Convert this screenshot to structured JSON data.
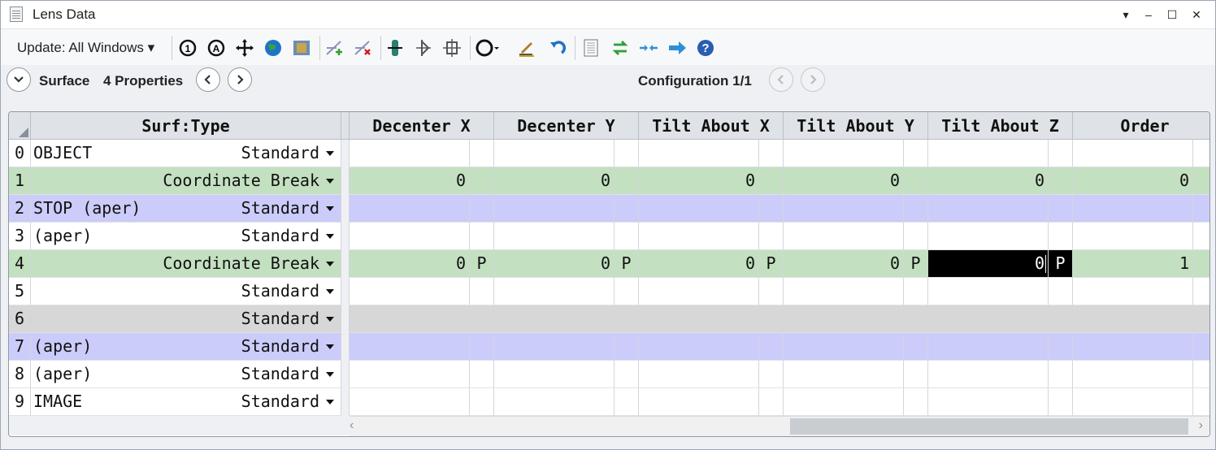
{
  "window": {
    "title": "Lens Data",
    "controls": [
      "▾",
      "–",
      "☐",
      "✕"
    ]
  },
  "toolbar": {
    "update_label": "Update: All Windows ▾"
  },
  "nav": {
    "surface_label": "Surface",
    "properties_label": "4 Properties",
    "config_label": "Configuration 1/1"
  },
  "grid": {
    "surf_header": "Surf:Type",
    "columns": [
      "Decenter X",
      "Decenter Y",
      "Tilt About X",
      "Tilt About Y",
      "Tilt About Z",
      "Order"
    ],
    "rows": [
      {
        "num": "0",
        "comment": "OBJECT",
        "type": "Standard",
        "style": "white",
        "cells": [
          "",
          "",
          "",
          "",
          "",
          ""
        ],
        "solves": [
          "",
          "",
          "",
          "",
          "",
          ""
        ]
      },
      {
        "num": "1",
        "comment": "",
        "type": "Coordinate Break",
        "style": "green",
        "cells": [
          "0",
          "0",
          "0",
          "0",
          "0",
          "0"
        ],
        "solves": [
          "",
          "",
          "",
          "",
          "",
          ""
        ]
      },
      {
        "num": "2",
        "comment": "STOP (aper)",
        "type": "Standard",
        "style": "blue",
        "cells": [
          "",
          "",
          "",
          "",
          "",
          ""
        ],
        "solves": [
          "",
          "",
          "",
          "",
          "",
          ""
        ]
      },
      {
        "num": "3",
        "comment": "(aper)",
        "type": "Standard",
        "style": "white",
        "cells": [
          "",
          "",
          "",
          "",
          "",
          ""
        ],
        "solves": [
          "",
          "",
          "",
          "",
          "",
          ""
        ]
      },
      {
        "num": "4",
        "comment": "",
        "type": "Coordinate Break",
        "style": "green",
        "cells": [
          "0",
          "0",
          "0",
          "0",
          "0",
          "1"
        ],
        "solves": [
          "P",
          "P",
          "P",
          "P",
          "P",
          ""
        ],
        "selected_col": 4
      },
      {
        "num": "5",
        "comment": "",
        "type": "Standard",
        "style": "white",
        "cells": [
          "",
          "",
          "",
          "",
          "",
          ""
        ],
        "solves": [
          "",
          "",
          "",
          "",
          "",
          ""
        ]
      },
      {
        "num": "6",
        "comment": "",
        "type": "Standard",
        "style": "gray",
        "cells": [
          "",
          "",
          "",
          "",
          "",
          ""
        ],
        "solves": [
          "",
          "",
          "",
          "",
          "",
          ""
        ]
      },
      {
        "num": "7",
        "comment": "(aper)",
        "type": "Standard",
        "style": "blue",
        "cells": [
          "",
          "",
          "",
          "",
          "",
          ""
        ],
        "solves": [
          "",
          "",
          "",
          "",
          "",
          ""
        ]
      },
      {
        "num": "8",
        "comment": "(aper)",
        "type": "Standard",
        "style": "white",
        "cells": [
          "",
          "",
          "",
          "",
          "",
          ""
        ],
        "solves": [
          "",
          "",
          "",
          "",
          "",
          ""
        ]
      },
      {
        "num": "9",
        "comment": "IMAGE",
        "type": "Standard",
        "style": "white",
        "cells": [
          "",
          "",
          "",
          "",
          "",
          ""
        ],
        "solves": [
          "",
          "",
          "",
          "",
          "",
          ""
        ]
      }
    ]
  },
  "colors": {
    "green": "#c3e0c1",
    "blue": "#ccccfa",
    "gray": "#d7d7d7",
    "white": "#ffffff",
    "header": "#dfe3e8"
  }
}
